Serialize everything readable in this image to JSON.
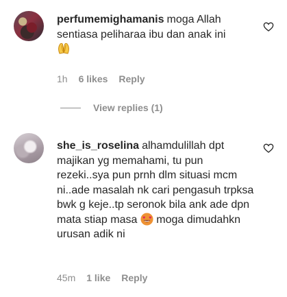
{
  "comments": [
    {
      "username": "perfumemighamanis",
      "text": "moga Allah sentiasa peliharaa ibu dan anak ini",
      "emoji": "folded-hands",
      "time": "1h",
      "likes": "6 likes",
      "reply": "Reply",
      "view_replies": "View replies (1)"
    },
    {
      "username": "she_is_roselina",
      "text_before_emoji": "alhamdulillah dpt majikan yg memahami, tu pun rezeki..sya pun prnh dlm situasi mcm ni..ade masalah nk cari pengasuh trpksa bwk g keje..tp seronok bila ank ade dpn mata stiap masa",
      "emoji": "heart-eyes-face",
      "text_after_emoji": "moga dimudahkn urusan adik ni",
      "time": "45m",
      "likes": "1 like",
      "reply": "Reply"
    }
  ],
  "icons": {
    "like": "heart-outline-icon"
  },
  "colors": {
    "text": "#262626",
    "secondary": "#8e8e8e",
    "background": "#ffffff"
  }
}
